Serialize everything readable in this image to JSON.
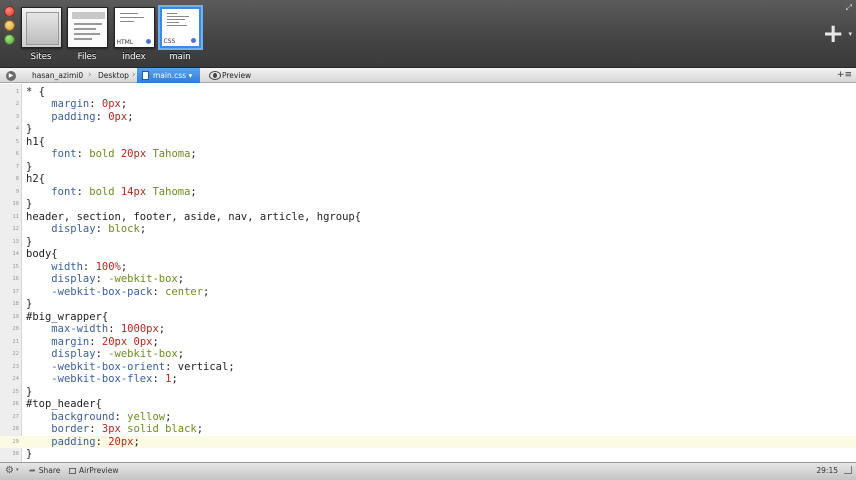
{
  "toolbar": {
    "sites": [
      {
        "label": "Sites",
        "kind": "sites"
      },
      {
        "label": "Files",
        "kind": "files"
      },
      {
        "label": "index",
        "kind": "html",
        "tag": "HTML"
      },
      {
        "label": "main",
        "kind": "css",
        "tag": "CSS",
        "selected": true
      }
    ],
    "add_icon": "+",
    "add_caret": "▾"
  },
  "pathbar": {
    "crumbs": [
      "hasan_azimi0",
      "Desktop",
      "main.css ▾"
    ],
    "preview_label": "Preview",
    "menu_icon": "+≡"
  },
  "editor": {
    "current_line": 29,
    "lines": [
      [
        [
          "* {",
          "plain"
        ]
      ],
      [
        [
          "    ",
          "plain"
        ],
        [
          "margin",
          "prop"
        ],
        [
          ": ",
          "plain"
        ],
        [
          "0px",
          "num"
        ],
        [
          ";",
          "plain"
        ]
      ],
      [
        [
          "    ",
          "plain"
        ],
        [
          "padding",
          "prop"
        ],
        [
          ": ",
          "plain"
        ],
        [
          "0px",
          "num"
        ],
        [
          ";",
          "plain"
        ]
      ],
      [
        [
          "}",
          "plain"
        ]
      ],
      [
        [
          "h1{",
          "plain"
        ]
      ],
      [
        [
          "    ",
          "plain"
        ],
        [
          "font",
          "prop"
        ],
        [
          ": ",
          "plain"
        ],
        [
          "bold ",
          "val"
        ],
        [
          "20px",
          "num"
        ],
        [
          " Tahoma",
          "val"
        ],
        [
          ";",
          "plain"
        ]
      ],
      [
        [
          "}",
          "plain"
        ]
      ],
      [
        [
          "h2{",
          "plain"
        ]
      ],
      [
        [
          "    ",
          "plain"
        ],
        [
          "font",
          "prop"
        ],
        [
          ": ",
          "plain"
        ],
        [
          "bold ",
          "val"
        ],
        [
          "14px",
          "num"
        ],
        [
          " Tahoma",
          "val"
        ],
        [
          ";",
          "plain"
        ]
      ],
      [
        [
          "}",
          "plain"
        ]
      ],
      [
        [
          "header, section, footer, aside, nav, article, hgroup{",
          "plain"
        ]
      ],
      [
        [
          "    ",
          "plain"
        ],
        [
          "display",
          "prop"
        ],
        [
          ": ",
          "plain"
        ],
        [
          "block",
          "val"
        ],
        [
          ";",
          "plain"
        ]
      ],
      [
        [
          "}",
          "plain"
        ]
      ],
      [
        [
          "body{",
          "plain"
        ]
      ],
      [
        [
          "    ",
          "plain"
        ],
        [
          "width",
          "prop"
        ],
        [
          ": ",
          "plain"
        ],
        [
          "100%",
          "num"
        ],
        [
          ";",
          "plain"
        ]
      ],
      [
        [
          "    ",
          "plain"
        ],
        [
          "display",
          "prop"
        ],
        [
          ": ",
          "plain"
        ],
        [
          "-webkit-box",
          "val"
        ],
        [
          ";",
          "plain"
        ]
      ],
      [
        [
          "    ",
          "plain"
        ],
        [
          "-webkit-box-pack",
          "prop"
        ],
        [
          ": ",
          "plain"
        ],
        [
          "center",
          "val"
        ],
        [
          ";",
          "plain"
        ]
      ],
      [
        [
          "}",
          "plain"
        ]
      ],
      [
        [
          "#big_wrapper{",
          "plain"
        ]
      ],
      [
        [
          "    ",
          "plain"
        ],
        [
          "max-width",
          "prop"
        ],
        [
          ": ",
          "plain"
        ],
        [
          "1000px",
          "num"
        ],
        [
          ";",
          "plain"
        ]
      ],
      [
        [
          "    ",
          "plain"
        ],
        [
          "margin",
          "prop"
        ],
        [
          ": ",
          "plain"
        ],
        [
          "20px 0px",
          "num"
        ],
        [
          ";",
          "plain"
        ]
      ],
      [
        [
          "    ",
          "plain"
        ],
        [
          "display",
          "prop"
        ],
        [
          ": ",
          "plain"
        ],
        [
          "-webkit-box",
          "val"
        ],
        [
          ";",
          "plain"
        ]
      ],
      [
        [
          "    ",
          "plain"
        ],
        [
          "-webkit-box-orient",
          "prop"
        ],
        [
          ": ",
          "plain"
        ],
        [
          "vertical",
          "plain"
        ],
        [
          ";",
          "plain"
        ]
      ],
      [
        [
          "    ",
          "plain"
        ],
        [
          "-webkit-box-flex",
          "prop"
        ],
        [
          ": ",
          "plain"
        ],
        [
          "1",
          "num"
        ],
        [
          ";",
          "plain"
        ]
      ],
      [
        [
          "}",
          "plain"
        ]
      ],
      [
        [
          "#top_header{",
          "plain"
        ]
      ],
      [
        [
          "    ",
          "plain"
        ],
        [
          "background",
          "prop"
        ],
        [
          ": ",
          "plain"
        ],
        [
          "yellow",
          "val"
        ],
        [
          ";",
          "plain"
        ]
      ],
      [
        [
          "    ",
          "plain"
        ],
        [
          "border",
          "prop"
        ],
        [
          ": ",
          "plain"
        ],
        [
          "3px",
          "num"
        ],
        [
          " solid black",
          "val"
        ],
        [
          ";",
          "plain"
        ]
      ],
      [
        [
          "    ",
          "plain"
        ],
        [
          "padding",
          "prop"
        ],
        [
          ": ",
          "plain"
        ],
        [
          "20px",
          "num"
        ],
        [
          ";",
          "plain"
        ]
      ],
      [
        [
          "}",
          "plain"
        ]
      ]
    ]
  },
  "statusbar": {
    "gear_icon": "⚙",
    "gear_caret": "▾",
    "share_label": "Share",
    "share_icon": "➦",
    "airpreview_label": "AirPreview",
    "cursor_position": "29:15"
  },
  "colors": {
    "property": "#3a5f9b",
    "number": "#b2281f",
    "value": "#6f8a1f",
    "selection_accent": "#3b8be2"
  }
}
